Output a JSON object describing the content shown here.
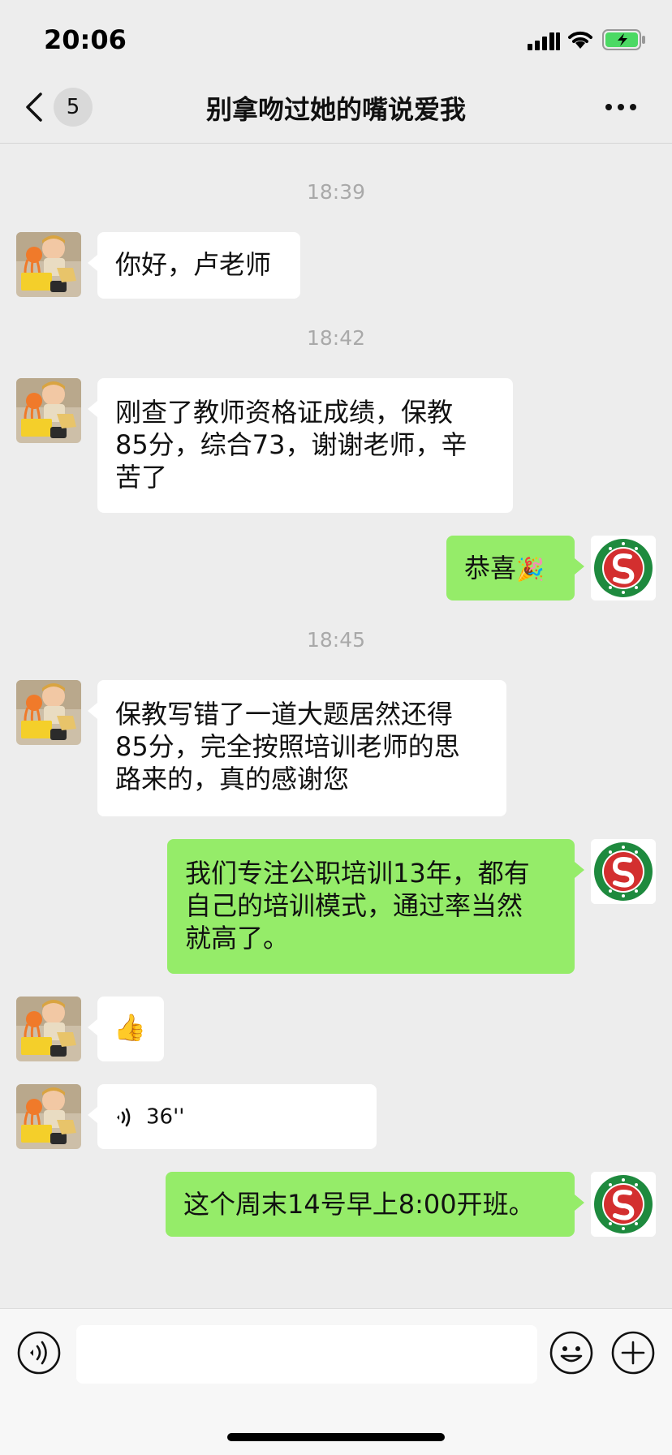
{
  "status_bar": {
    "time": "20:06",
    "battery_color": "#4cd964"
  },
  "header": {
    "back_icon": "chevron-left-icon",
    "unread_count": "5",
    "title": "别拿吻过她的嘴说爱我",
    "more_icon": "ellipsis-icon"
  },
  "timestamps": [
    "18:39",
    "18:42",
    "18:45"
  ],
  "messages": [
    {
      "side": "in",
      "type": "text",
      "text": "你好，卢老师"
    },
    {
      "side": "in",
      "type": "text",
      "lines": [
        "刚查了教师资格证成绩，保教",
        "85分，综合73，谢谢老师，辛",
        "苦了"
      ]
    },
    {
      "side": "out",
      "type": "text",
      "text": "恭喜",
      "emoji": "🎉"
    },
    {
      "side": "in",
      "type": "text",
      "lines": [
        "保教写错了一道大题居然还得",
        "85分，完全按照培训老师的思",
        "路来的，真的感谢您"
      ]
    },
    {
      "side": "out",
      "type": "text",
      "lines": [
        "我们专注公职培训13年，都有",
        "自己的培训模式，通过率当然",
        "就高了。"
      ]
    },
    {
      "side": "in",
      "type": "emoji",
      "emoji": "👍"
    },
    {
      "side": "in",
      "type": "voice",
      "duration": "36''"
    },
    {
      "side": "out",
      "type": "text",
      "text": "这个周末14号早上8:00开班。"
    }
  ],
  "input_bar": {
    "voice_icon": "voice-icon",
    "emoji_icon": "smiley-icon",
    "plus_icon": "plus-icon"
  },
  "colors": {
    "outgoing_bubble": "#95ec69",
    "incoming_bubble": "#ffffff",
    "background": "#ededed",
    "logo_red": "#d32f2f",
    "logo_green": "#1e8a3e"
  }
}
